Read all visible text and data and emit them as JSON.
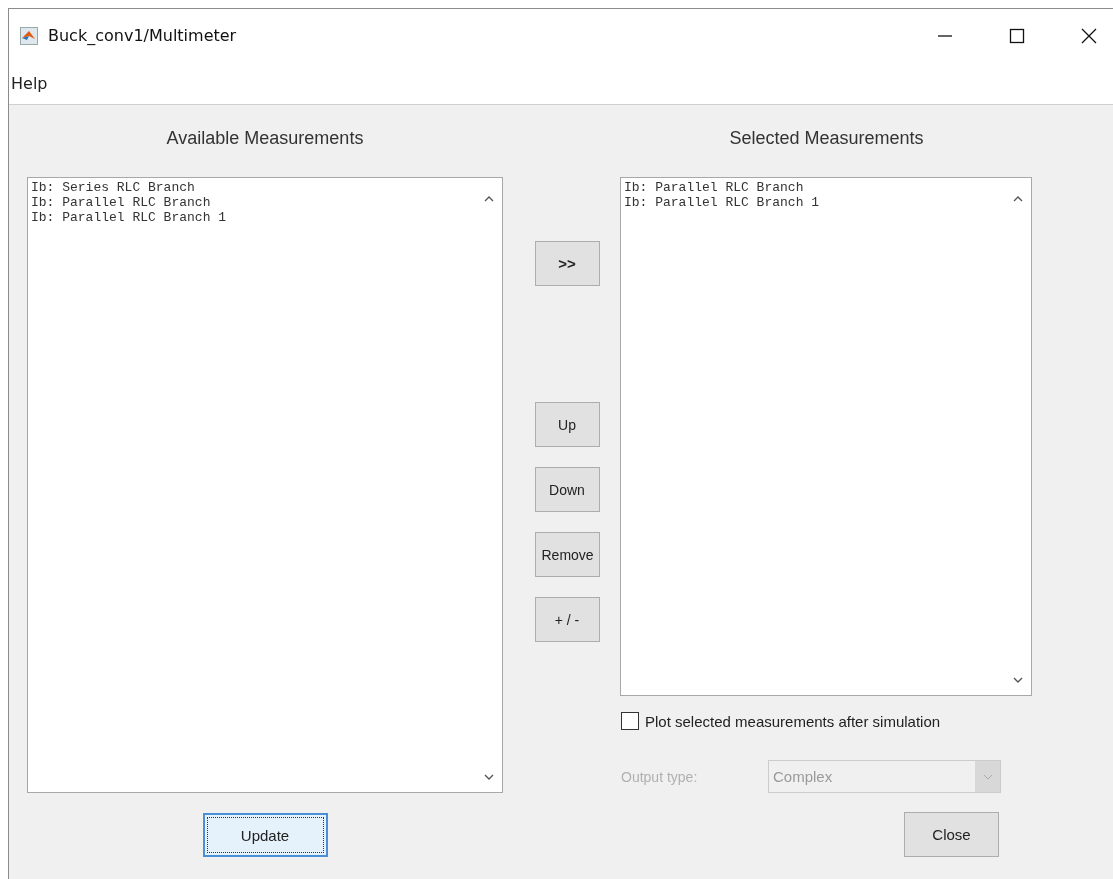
{
  "window": {
    "title": "Buck_conv1/Multimeter"
  },
  "menu": [
    "Help"
  ],
  "available": {
    "title": "Available Measurements",
    "items": [
      "Ib: Series RLC Branch",
      "Ib: Parallel RLC Branch",
      "Ib: Parallel RLC Branch 1"
    ]
  },
  "middle_buttons": [
    {
      "label": ">>",
      "kind": "add"
    },
    {
      "label": "Up",
      "kind": "edit"
    },
    {
      "label": "Down",
      "kind": "edit"
    },
    {
      "label": "Remove",
      "kind": "edit"
    },
    {
      "label": "+ / -",
      "kind": "edit"
    }
  ],
  "selected": {
    "title": "Selected Measurements",
    "items": [
      "Ib: Parallel RLC Branch",
      "Ib: Parallel RLC Branch 1"
    ]
  },
  "plot_option": {
    "label": "Plot selected measurements after simulation",
    "checked": false
  },
  "output_type": {
    "label": "Output type:",
    "value": "Complex",
    "disabled": true
  },
  "update_button": {
    "label": "Update",
    "focused": true
  },
  "close_button": {
    "label": "Close",
    "focused": false
  }
}
